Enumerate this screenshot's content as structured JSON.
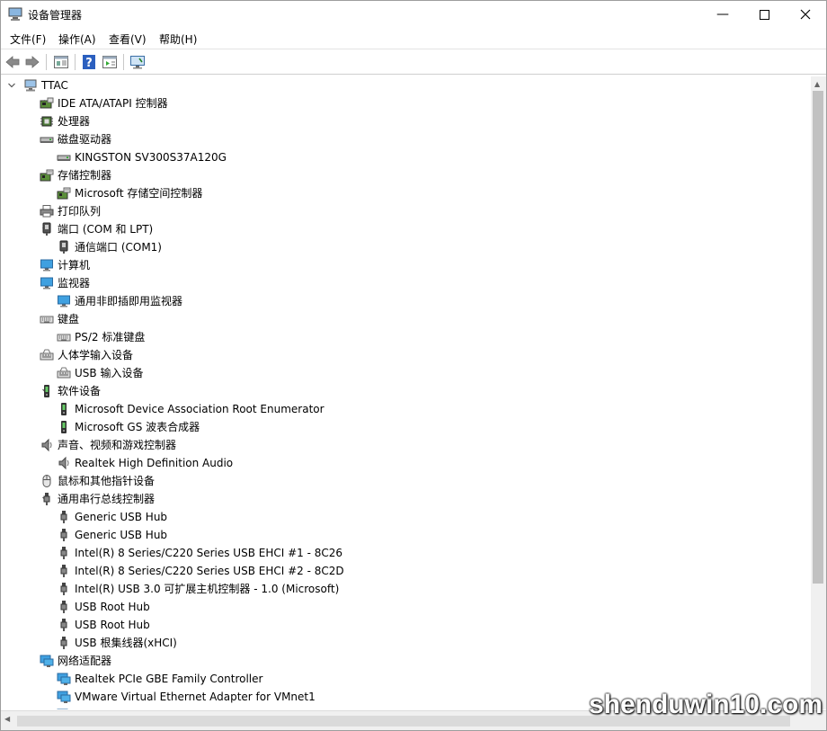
{
  "window": {
    "title": "设备管理器"
  },
  "menu": [
    "文件(F)",
    "操作(A)",
    "查看(V)",
    "帮助(H)"
  ],
  "toolbar_icons": [
    "back-icon",
    "forward-icon",
    "properties-list-icon",
    "help-icon",
    "properties-icon",
    "monitor-scan-icon"
  ],
  "tree": [
    {
      "level": 0,
      "state": "expanded",
      "label": "TTAC",
      "icon": "computer-icon"
    },
    {
      "level": 1,
      "state": "collapsed",
      "label": "IDE ATA/ATAPI 控制器",
      "icon": "ide-controller-icon"
    },
    {
      "level": 1,
      "state": "collapsed",
      "label": "处理器",
      "icon": "processor-icon"
    },
    {
      "level": 1,
      "state": "expanded",
      "label": "磁盘驱动器",
      "icon": "disk-drive-icon"
    },
    {
      "level": 2,
      "state": "leaf",
      "label": "KINGSTON SV300S37A120G",
      "icon": "disk-drive-icon"
    },
    {
      "level": 1,
      "state": "expanded",
      "label": "存储控制器",
      "icon": "storage-controller-icon"
    },
    {
      "level": 2,
      "state": "leaf",
      "label": "Microsoft 存储空间控制器",
      "icon": "storage-controller-icon"
    },
    {
      "level": 1,
      "state": "collapsed",
      "label": "打印队列",
      "icon": "printer-icon"
    },
    {
      "level": 1,
      "state": "expanded",
      "label": "端口 (COM 和 LPT)",
      "icon": "port-icon"
    },
    {
      "level": 2,
      "state": "leaf",
      "label": "通信端口 (COM1)",
      "icon": "port-icon"
    },
    {
      "level": 1,
      "state": "collapsed",
      "label": "计算机",
      "icon": "monitor-icon"
    },
    {
      "level": 1,
      "state": "expanded",
      "label": "监视器",
      "icon": "monitor-icon"
    },
    {
      "level": 2,
      "state": "leaf",
      "label": "通用非即插即用监视器",
      "icon": "monitor-icon"
    },
    {
      "level": 1,
      "state": "expanded",
      "label": "键盘",
      "icon": "keyboard-icon"
    },
    {
      "level": 2,
      "state": "leaf",
      "label": "PS/2 标准键盘",
      "icon": "keyboard-icon"
    },
    {
      "level": 1,
      "state": "expanded",
      "label": "人体学输入设备",
      "icon": "hid-icon"
    },
    {
      "level": 2,
      "state": "leaf",
      "label": "USB 输入设备",
      "icon": "hid-icon"
    },
    {
      "level": 1,
      "state": "expanded",
      "label": "软件设备",
      "icon": "software-device-icon"
    },
    {
      "level": 2,
      "state": "leaf",
      "label": "Microsoft Device Association Root Enumerator",
      "icon": "software-device-icon"
    },
    {
      "level": 2,
      "state": "leaf",
      "label": "Microsoft GS 波表合成器",
      "icon": "software-device-icon"
    },
    {
      "level": 1,
      "state": "expanded",
      "label": "声音、视频和游戏控制器",
      "icon": "speaker-icon"
    },
    {
      "level": 2,
      "state": "leaf",
      "label": "Realtek High Definition Audio",
      "icon": "speaker-icon"
    },
    {
      "level": 1,
      "state": "collapsed",
      "label": "鼠标和其他指针设备",
      "icon": "mouse-icon"
    },
    {
      "level": 1,
      "state": "expanded",
      "label": "通用串行总线控制器",
      "icon": "usb-icon"
    },
    {
      "level": 2,
      "state": "leaf",
      "label": "Generic USB Hub",
      "icon": "usb-icon"
    },
    {
      "level": 2,
      "state": "leaf",
      "label": "Generic USB Hub",
      "icon": "usb-icon"
    },
    {
      "level": 2,
      "state": "leaf",
      "label": "Intel(R) 8 Series/C220 Series USB EHCI #1 - 8C26",
      "icon": "usb-icon"
    },
    {
      "level": 2,
      "state": "leaf",
      "label": "Intel(R) 8 Series/C220 Series USB EHCI #2 - 8C2D",
      "icon": "usb-icon"
    },
    {
      "level": 2,
      "state": "leaf",
      "label": "Intel(R) USB 3.0 可扩展主机控制器 - 1.0 (Microsoft)",
      "icon": "usb-icon"
    },
    {
      "level": 2,
      "state": "leaf",
      "label": "USB Root Hub",
      "icon": "usb-icon"
    },
    {
      "level": 2,
      "state": "leaf",
      "label": "USB Root Hub",
      "icon": "usb-icon"
    },
    {
      "level": 2,
      "state": "leaf",
      "label": "USB 根集线器(xHCI)",
      "icon": "usb-icon"
    },
    {
      "level": 1,
      "state": "expanded",
      "label": "网络适配器",
      "icon": "network-icon"
    },
    {
      "level": 2,
      "state": "leaf",
      "label": "Realtek PCIe GBE Family Controller",
      "icon": "network-icon"
    },
    {
      "level": 2,
      "state": "leaf",
      "label": "VMware Virtual Ethernet Adapter for VMnet1",
      "icon": "network-icon"
    },
    {
      "level": 2,
      "state": "leaf",
      "label": "",
      "icon": "network-icon"
    }
  ],
  "watermark": "shenduwin10.com"
}
